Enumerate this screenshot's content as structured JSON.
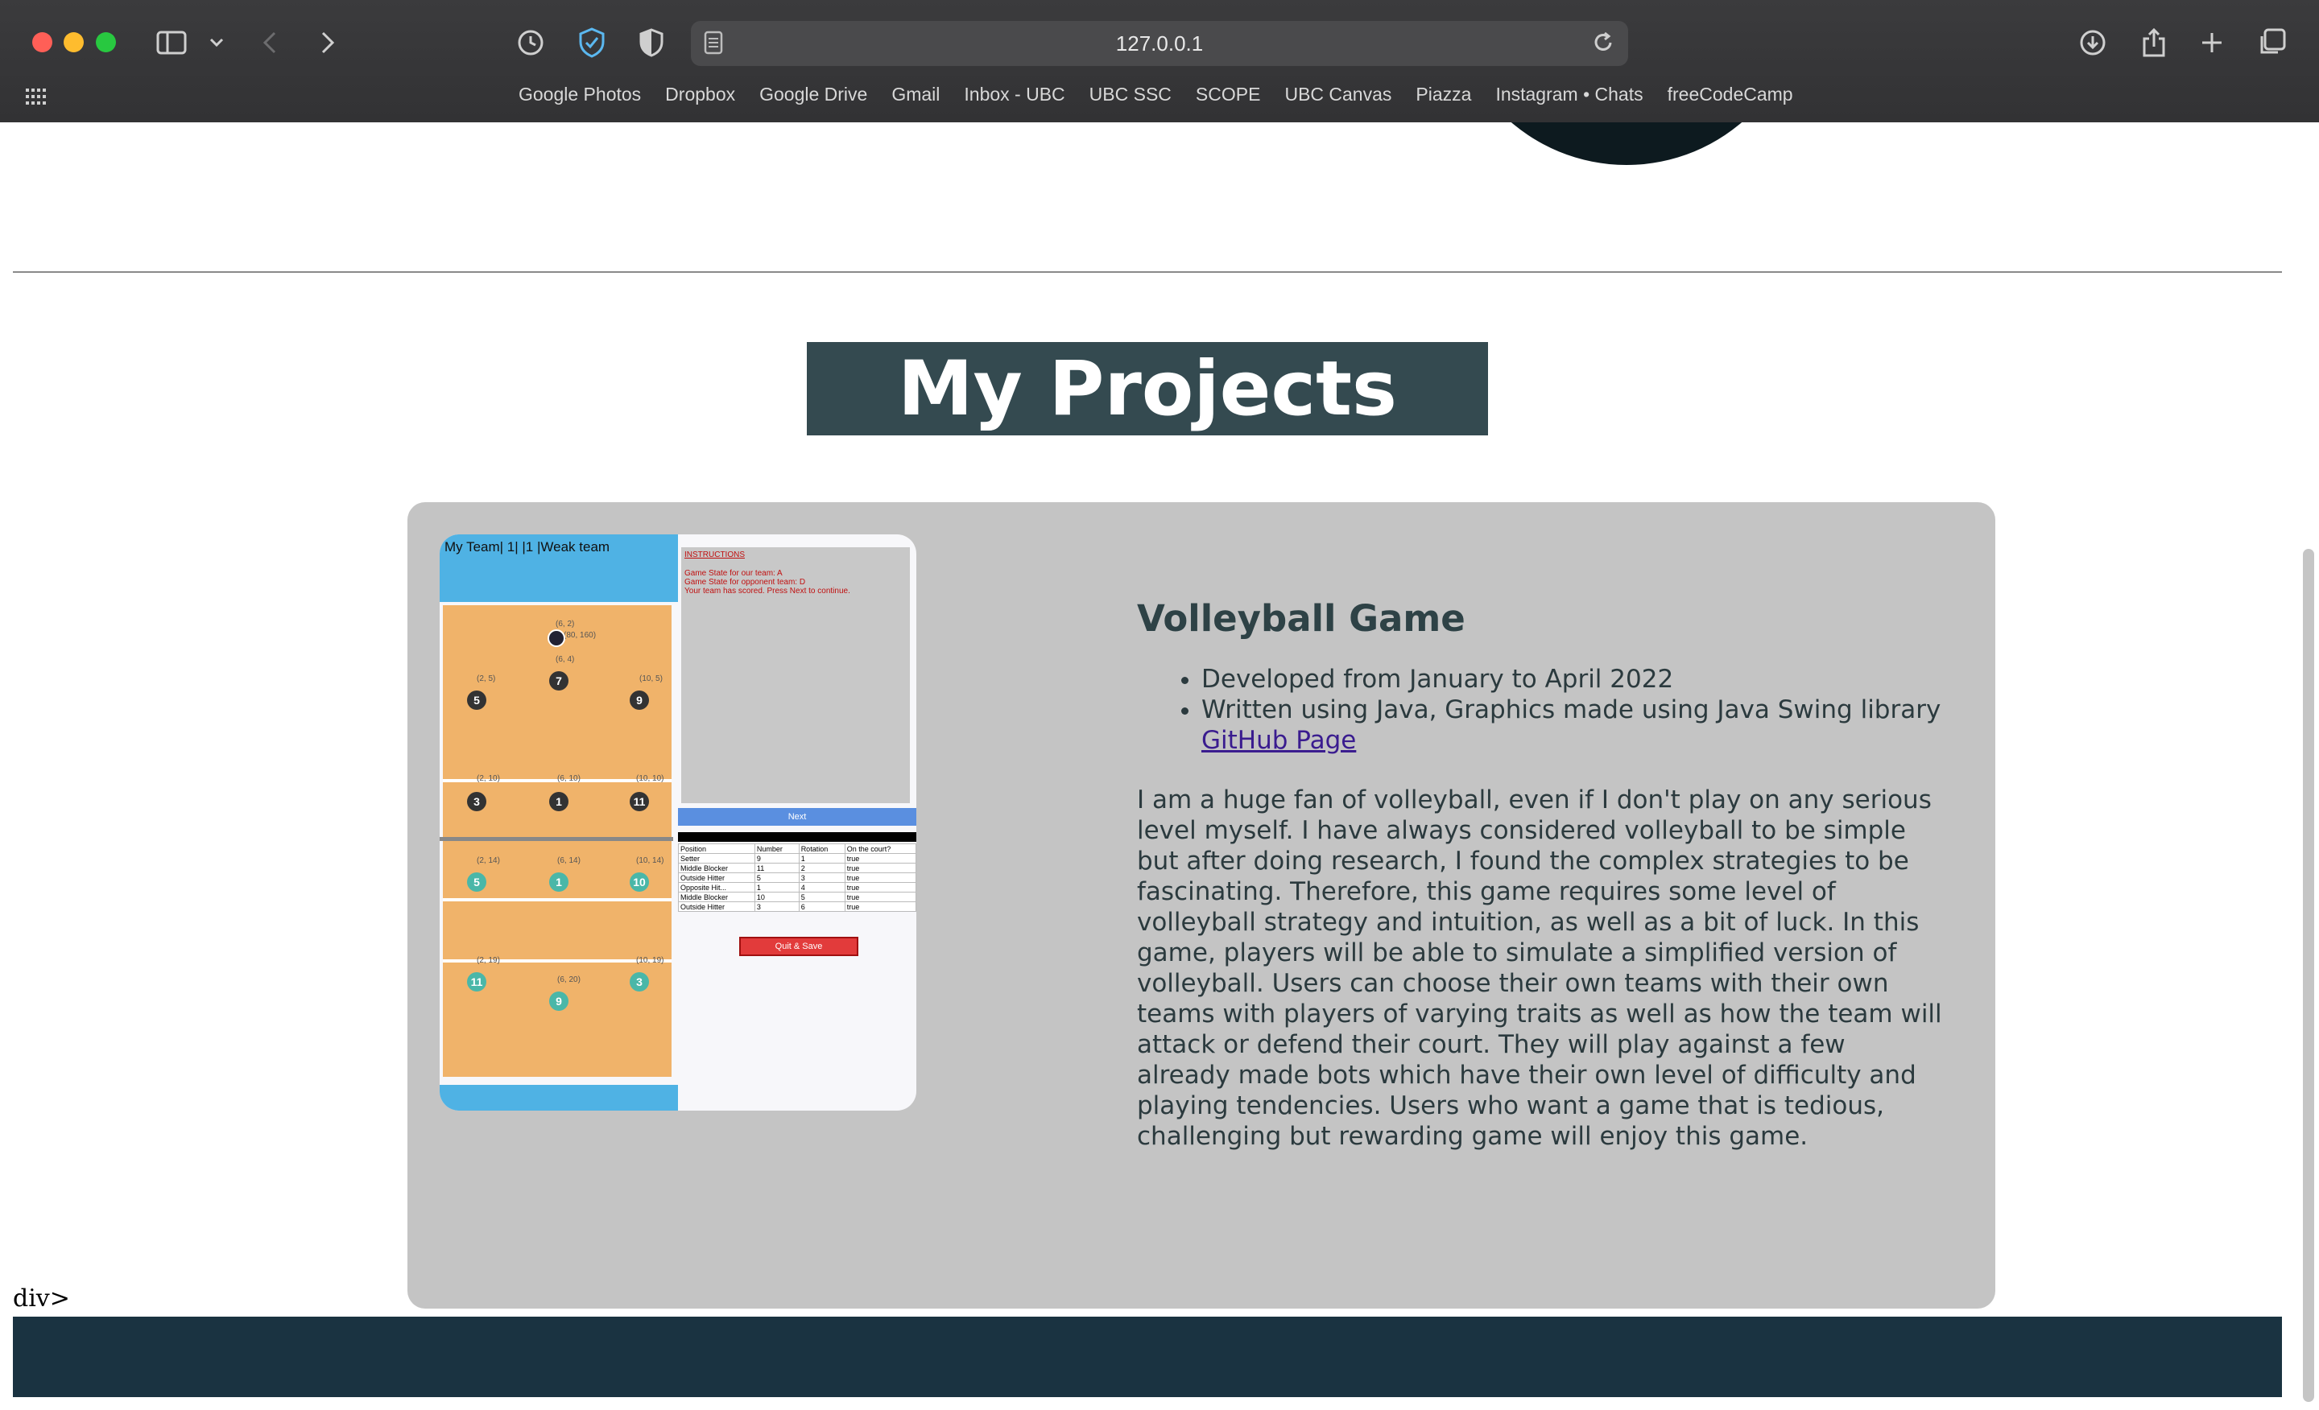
{
  "browser": {
    "address": "127.0.0.1",
    "bookmarks": [
      "Google Photos",
      "Dropbox",
      "Google Drive",
      "Gmail",
      "Inbox - UBC",
      "UBC SSC",
      "SCOPE",
      "UBC Canvas",
      "Piazza",
      "Instagram • Chats",
      "freeCodeCamp"
    ]
  },
  "page": {
    "section_title": "My Projects",
    "stray_text": "div>",
    "project": {
      "title": "Volleyball Game",
      "bullets": [
        "Developed from January to April 2022",
        "Written using Java, Graphics made using Java Swing library"
      ],
      "link_label": "GitHub Page",
      "description": "I am a huge fan of volleyball, even if I don't play on any serious level myself. I have always considered volleyball to be simple but after doing research, I found the complex strategies to be fascinating. Therefore, this game requires some level of volleyball strategy and intuition, as well as a bit of luck. In this game, players will be able to simulate a simplified version of volleyball. Users can choose their own teams with their own teams with players of varying traits as well as how the team will attack or defend their court. They will play against a few already made bots which have their own level of difficulty and playing tendencies. Users who want a game that is tedious, challenging but rewarding game will enjoy this game.",
      "screenshot": {
        "team_label": "My Team| 1| |1 |Weak team",
        "instructions_title": "INSTRUCTIONS",
        "instructions_lines": [
          "Game State for our team: A",
          "Game State for opponent team: D",
          "Your team has scored. Press Next to continue."
        ],
        "next_label": "Next",
        "quit_label": "Quit & Save",
        "table_headers": [
          "Position",
          "Number",
          "Rotation",
          "On the court?"
        ],
        "table_rows": [
          [
            "Setter",
            "9",
            "1",
            "true"
          ],
          [
            "Middle Blocker",
            "11",
            "2",
            "true"
          ],
          [
            "Outside Hitter",
            "5",
            "3",
            "true"
          ],
          [
            "Opposite Hit...",
            "1",
            "4",
            "true"
          ],
          [
            "Middle Blocker",
            "10",
            "5",
            "true"
          ],
          [
            "Outside Hitter",
            "3",
            "6",
            "true"
          ]
        ],
        "players": [
          {
            "number": "7",
            "coord": "(6, 4)",
            "team": "dark"
          },
          {
            "number": "5",
            "coord": "(2, 5)",
            "team": "dark"
          },
          {
            "number": "9",
            "coord": "(10, 5)",
            "team": "dark"
          },
          {
            "number": "3",
            "coord": "(2, 10)",
            "team": "dark"
          },
          {
            "number": "1",
            "coord": "(6, 10)",
            "team": "dark"
          },
          {
            "number": "11",
            "coord": "(10, 10)",
            "team": "dark"
          },
          {
            "number": "5",
            "coord": "(2, 14)",
            "team": "teal"
          },
          {
            "number": "1",
            "coord": "(6, 14)",
            "team": "teal"
          },
          {
            "number": "10",
            "coord": "(10, 14)",
            "team": "teal"
          },
          {
            "number": "11",
            "coord": "(2, 19)",
            "team": "teal"
          },
          {
            "number": "9",
            "coord": "(6, 20)",
            "team": "teal"
          },
          {
            "number": "3",
            "coord": "(10, 19)",
            "team": "teal"
          }
        ],
        "ball_coord": "(6, 2)",
        "ball_pixel_label": "(80, 160)"
      }
    }
  }
}
